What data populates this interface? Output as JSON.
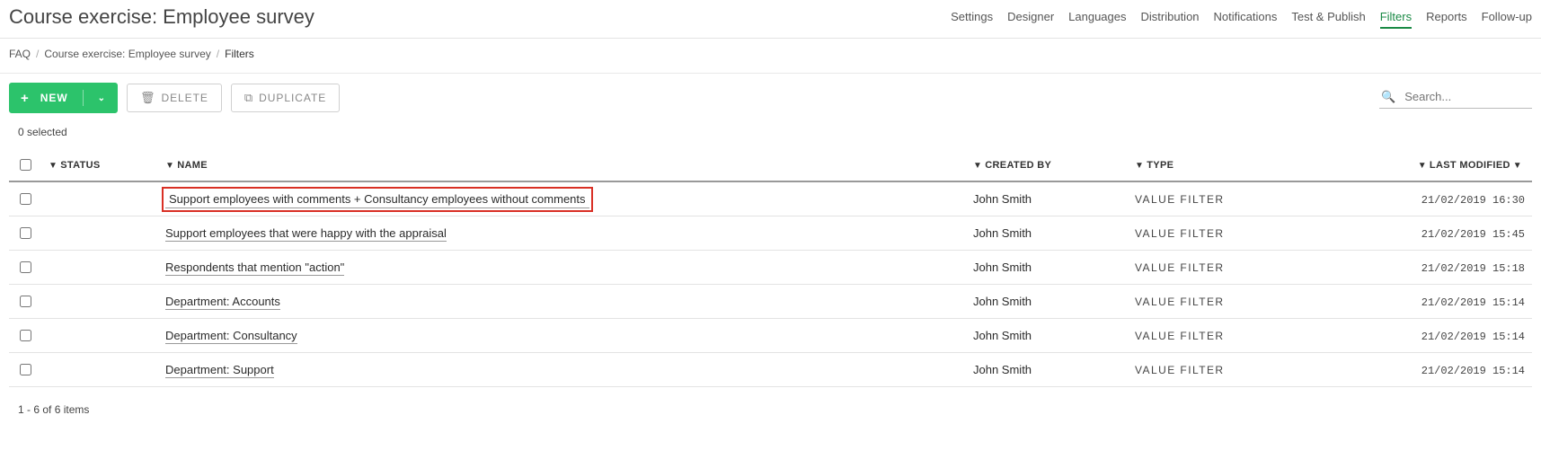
{
  "header": {
    "title": "Course exercise: Employee survey",
    "nav_items": [
      {
        "label": "Settings",
        "active": false
      },
      {
        "label": "Designer",
        "active": false
      },
      {
        "label": "Languages",
        "active": false
      },
      {
        "label": "Distribution",
        "active": false
      },
      {
        "label": "Notifications",
        "active": false
      },
      {
        "label": "Test & Publish",
        "active": false
      },
      {
        "label": "Filters",
        "active": true
      },
      {
        "label": "Reports",
        "active": false
      },
      {
        "label": "Follow-up",
        "active": false
      }
    ]
  },
  "breadcrumbs": {
    "items": [
      "FAQ",
      "Course exercise: Employee survey",
      "Filters"
    ]
  },
  "toolbar": {
    "new_label": "NEW",
    "delete_label": "DELETE",
    "duplicate_label": "DUPLICATE",
    "search_placeholder": "Search..."
  },
  "selection_text": "0 selected",
  "table": {
    "columns": {
      "status": "STATUS",
      "name": "NAME",
      "created_by": "CREATED BY",
      "type": "TYPE",
      "last_modified": "LAST MODIFIED"
    },
    "rows": [
      {
        "name": "Support employees with comments + Consultancy employees without comments",
        "created_by": "John Smith",
        "type": "VALUE FILTER",
        "last_modified": "21/02/2019 16:30",
        "highlight": true
      },
      {
        "name": "Support employees that were happy with the appraisal",
        "created_by": "John Smith",
        "type": "VALUE FILTER",
        "last_modified": "21/02/2019 15:45",
        "highlight": false
      },
      {
        "name": "Respondents that mention \"action\"",
        "created_by": "John Smith",
        "type": "VALUE FILTER",
        "last_modified": "21/02/2019 15:18",
        "highlight": false
      },
      {
        "name": "Department: Accounts",
        "created_by": "John Smith",
        "type": "VALUE FILTER",
        "last_modified": "21/02/2019 15:14",
        "highlight": false
      },
      {
        "name": "Department: Consultancy",
        "created_by": "John Smith",
        "type": "VALUE FILTER",
        "last_modified": "21/02/2019 15:14",
        "highlight": false
      },
      {
        "name": "Department: Support",
        "created_by": "John Smith",
        "type": "VALUE FILTER",
        "last_modified": "21/02/2019 15:14",
        "highlight": false
      }
    ],
    "footer_text": "1 - 6 of 6 items"
  }
}
